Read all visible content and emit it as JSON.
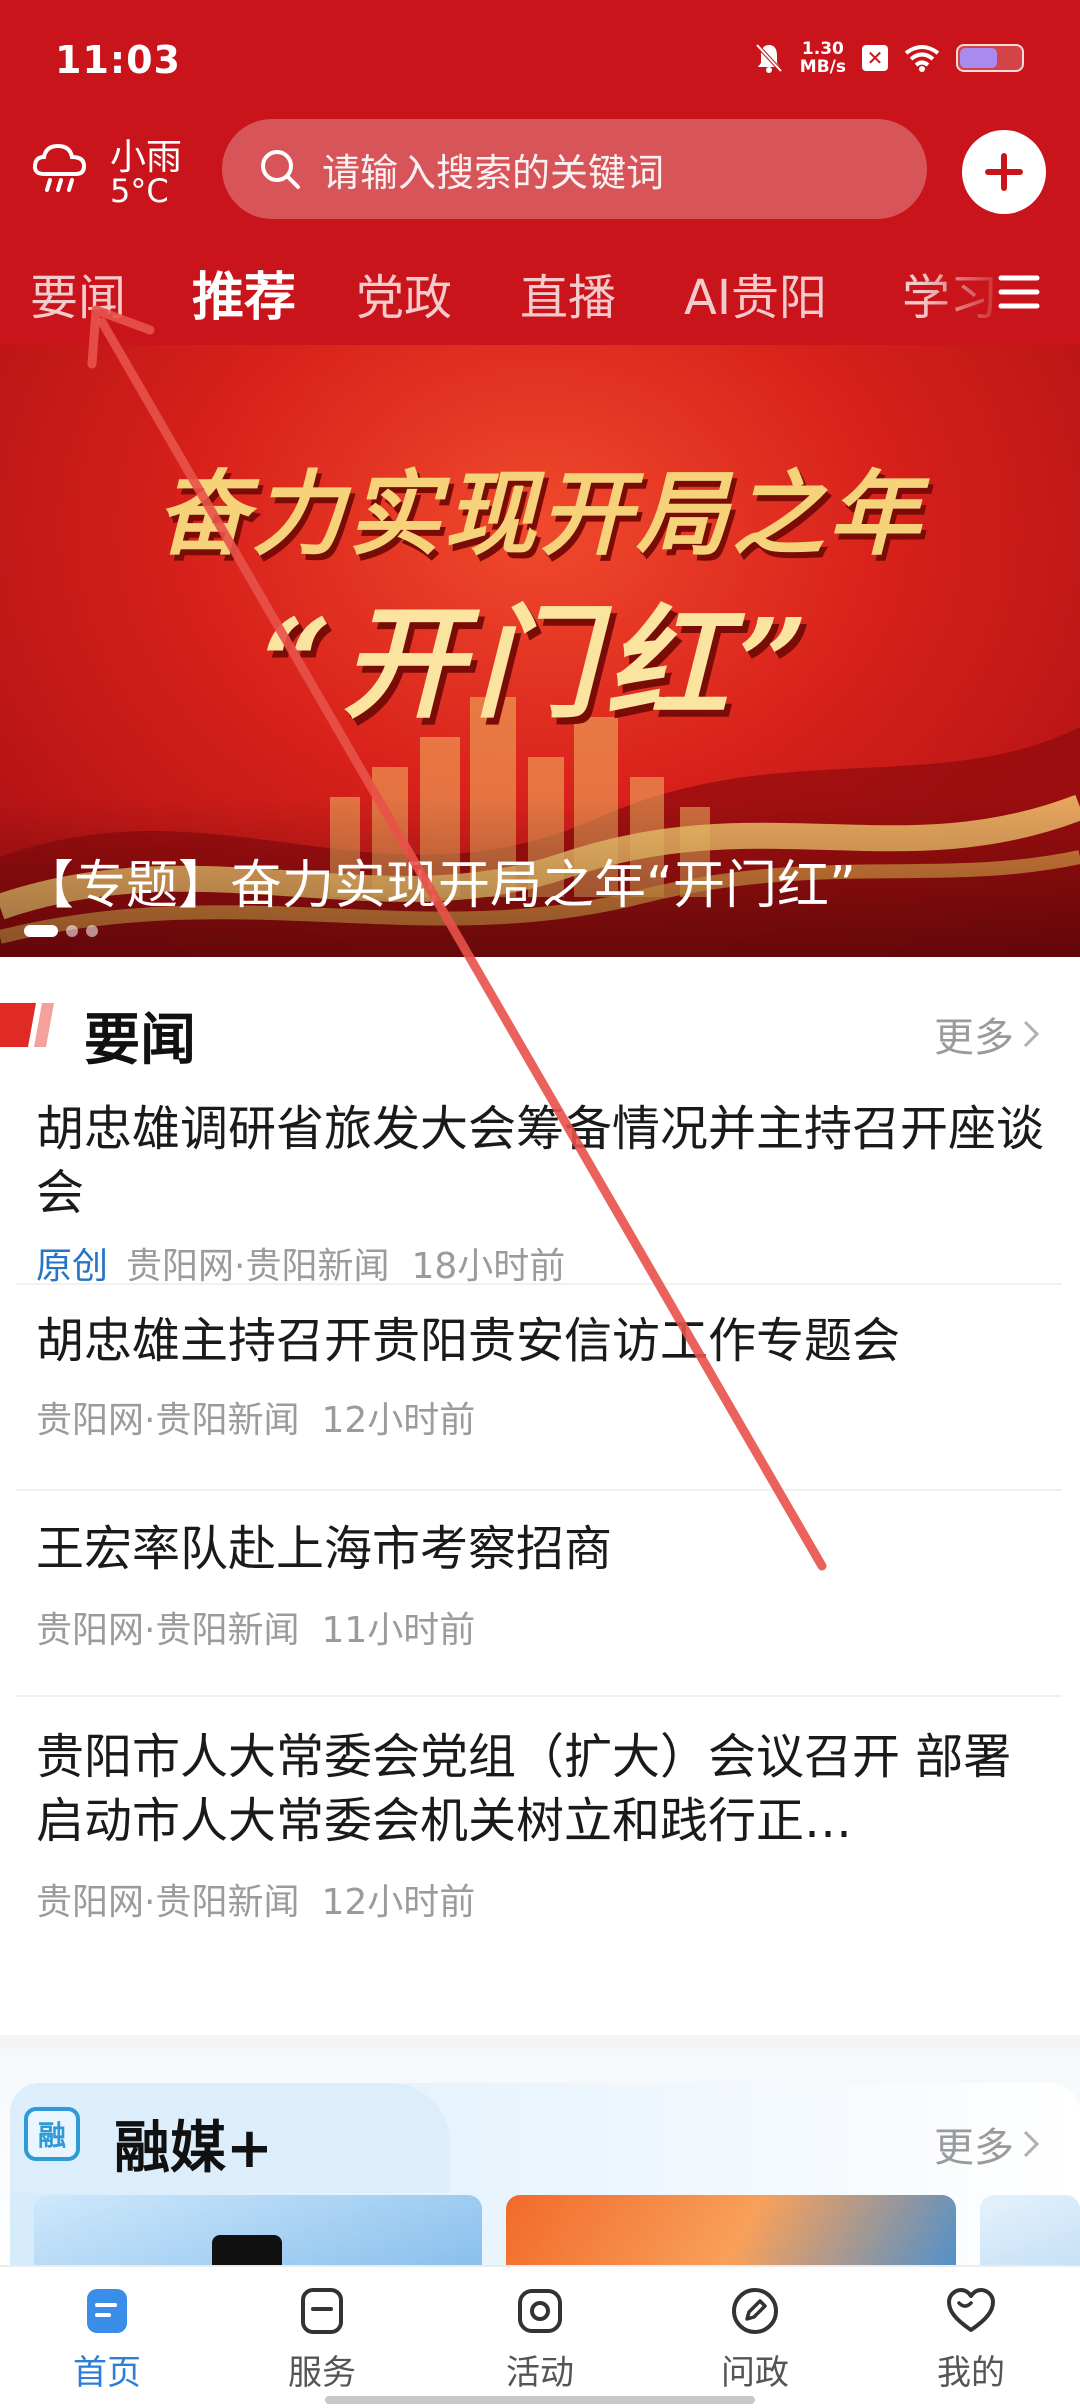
{
  "status_bar": {
    "time": "11:03",
    "speed_value": "1.30",
    "speed_unit": "MB/s",
    "icons": [
      "bell-off-icon",
      "x-badge-icon",
      "wifi-icon",
      "battery-icon"
    ]
  },
  "header": {
    "weather": {
      "condition": "小雨",
      "temp": "5°C",
      "icon": "rain-cloud-icon"
    },
    "search": {
      "placeholder": "请输入搜索的关键词"
    },
    "tabs": [
      {
        "label": "要闻",
        "active": false
      },
      {
        "label": "推荐",
        "active": true
      },
      {
        "label": "党政",
        "active": false
      },
      {
        "label": "直播",
        "active": false
      },
      {
        "label": "AI贵阳",
        "active": false
      },
      {
        "label": "学习",
        "active": false
      }
    ]
  },
  "banner": {
    "title_line1": "奋力实现开局之年",
    "title_line2": "“开门红”",
    "caption": "【专题】奋力实现开局之年“开门红”",
    "dots": 3,
    "active_dot": 0
  },
  "news_section": {
    "title": "要闻",
    "more_label": "更多",
    "items": [
      {
        "title": "胡忠雄调研省旅发大会筹备情况并主持召开座谈会",
        "tag": "原创",
        "source": "贵阳网·贵阳新闻",
        "time": "18小时前"
      },
      {
        "title": "胡忠雄主持召开贵阳贵安信访工作专题会",
        "tag": "",
        "source": "贵阳网·贵阳新闻",
        "time": "12小时前"
      },
      {
        "title": "王宏率队赴上海市考察招商",
        "tag": "",
        "source": "贵阳网·贵阳新闻",
        "time": "11小时前"
      },
      {
        "title": "贵阳市人大常委会党组（扩大）会议召开 部署启动市人大常委会机关树立和践行正…",
        "tag": "",
        "source": "贵阳网·贵阳新闻",
        "time": "12小时前"
      }
    ]
  },
  "rongmei_section": {
    "icon_text": "融",
    "title": "融媒+",
    "more_label": "更多"
  },
  "bottom_nav": [
    {
      "label": "首页",
      "icon": "home-doc-icon",
      "active": true
    },
    {
      "label": "服务",
      "icon": "service-icon",
      "active": false
    },
    {
      "label": "活动",
      "icon": "activity-icon",
      "active": false
    },
    {
      "label": "问政",
      "icon": "pen-icon",
      "active": false
    },
    {
      "label": "我的",
      "icon": "heart-icon",
      "active": false
    }
  ],
  "colors": {
    "brand_red": "#c8141a",
    "link_blue": "#2474c8",
    "nav_active_blue": "#2d7ed8",
    "annotation_arrow": "#e8524a"
  }
}
